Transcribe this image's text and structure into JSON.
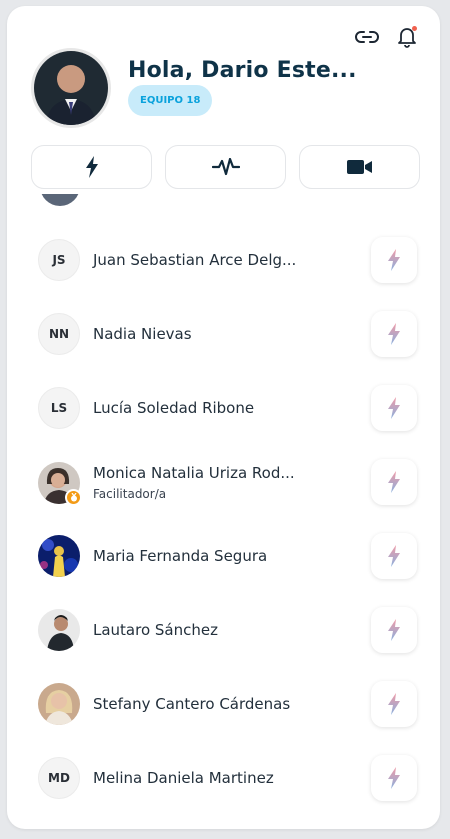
{
  "header": {
    "greeting": "Hola, Dario Este...",
    "team_badge": "EQUIPO 18"
  },
  "icons": {
    "link": "link-icon",
    "bell": "bell-icon",
    "tab_energy": "lightning-icon",
    "tab_activity": "pulse-icon",
    "tab_video": "video-camera-icon"
  },
  "colors": {
    "title": "#0f3348",
    "badge_bg": "#c8ebfa",
    "badge_text": "#0aa2dc",
    "notification_dot": "#f0614f",
    "medal": "#f39b17"
  },
  "members": [
    {
      "initials": "JS",
      "name": "Juan Sebastian Arce Delg...",
      "role": ""
    },
    {
      "initials": "NN",
      "name": "Nadia Nievas",
      "role": ""
    },
    {
      "initials": "LS",
      "name": "Lucía Soledad Ribone",
      "role": ""
    },
    {
      "initials": "",
      "name": "Monica Natalia Uriza Rod...",
      "role": "Facilitador/a"
    },
    {
      "initials": "",
      "name": "Maria Fernanda Segura",
      "role": ""
    },
    {
      "initials": "",
      "name": "Lautaro Sánchez",
      "role": ""
    },
    {
      "initials": "",
      "name": "Stefany Cantero Cárdenas",
      "role": ""
    },
    {
      "initials": "MD",
      "name": "Melina Daniela Martinez",
      "role": ""
    }
  ]
}
